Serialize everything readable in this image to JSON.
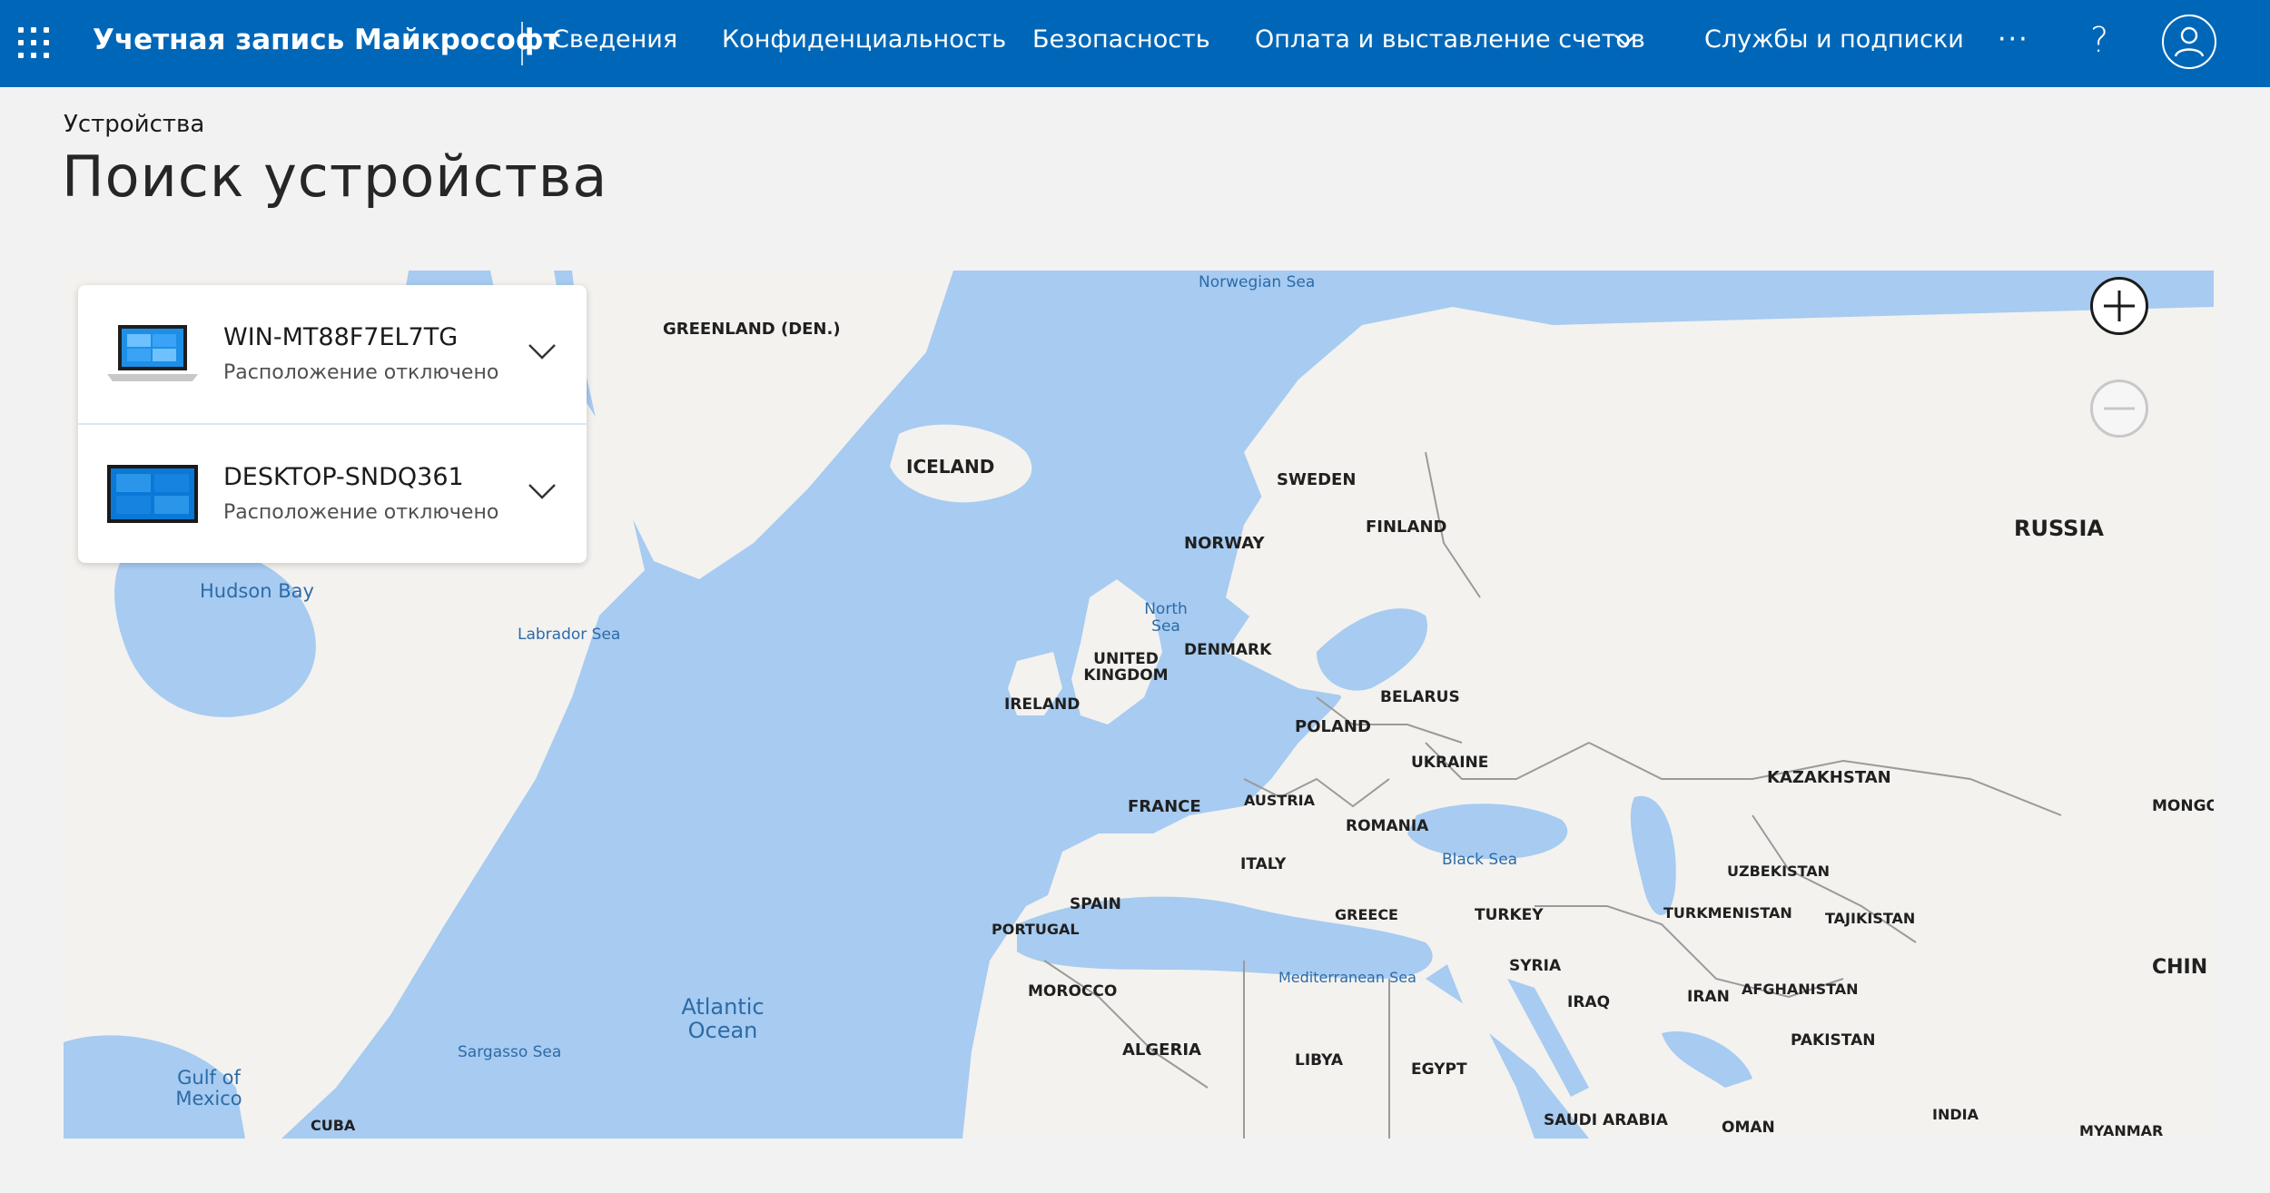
{
  "header": {
    "brand": "Учетная запись Майкрософт",
    "nav": [
      {
        "label": "Сведения"
      },
      {
        "label": "Конфиденциальность"
      },
      {
        "label": "Безопасность"
      },
      {
        "label": "Оплата и выставление счетов"
      },
      {
        "label": "Службы и подписки"
      }
    ],
    "more": "···",
    "help": "?"
  },
  "breadcrumb": "Устройства",
  "page_title": "Поиск устройства",
  "devices": [
    {
      "name": "WIN-MT88F7EL7TG",
      "status": "Расположение отключено",
      "icon": "laptop-icon"
    },
    {
      "name": "DESKTOP-SNDQ361",
      "status": "Расположение отключено",
      "icon": "monitor-icon"
    }
  ],
  "map": {
    "countries": [
      "GREENLAND (DEN.)",
      "ICELAND",
      "SWEDEN",
      "FINLAND",
      "NORWAY",
      "RUSSIA",
      "DENMARK",
      "UNITED KINGDOM",
      "IRELAND",
      "BELARUS",
      "POLAND",
      "UKRAINE",
      "KAZAKHSTAN",
      "FRANCE",
      "AUSTRIA",
      "ROMANIA",
      "MONGO",
      "ITALY",
      "UZBEKISTAN",
      "SPAIN",
      "GREECE",
      "TURKEY",
      "TURKMENISTAN",
      "TAJIKISTAN",
      "PORTUGAL",
      "SYRIA",
      "CHIN",
      "MOROCCO",
      "IRAQ",
      "IRAN",
      "AFGHANISTAN",
      "PAKISTAN",
      "ALGERIA",
      "LIBYA",
      "EGYPT",
      "INDIA",
      "SAUDI ARABIA",
      "CUBA",
      "OMAN",
      "MYANMAR"
    ],
    "waters": [
      "Norwegian Sea",
      "Hudson Bay",
      "Labrador Sea",
      "North Sea",
      "Black Sea",
      "Atlantic Ocean",
      "Mediterranean Sea",
      "Sargasso Sea",
      "Gulf of Mexico"
    ],
    "water_color": "#a7cbf1",
    "land_color": "#f3f2ef",
    "border_color": "#9a9a9a"
  },
  "colors": {
    "header_bg": "#0067b8",
    "page_bg": "#f2f2f2",
    "accent": "#0067b8"
  }
}
